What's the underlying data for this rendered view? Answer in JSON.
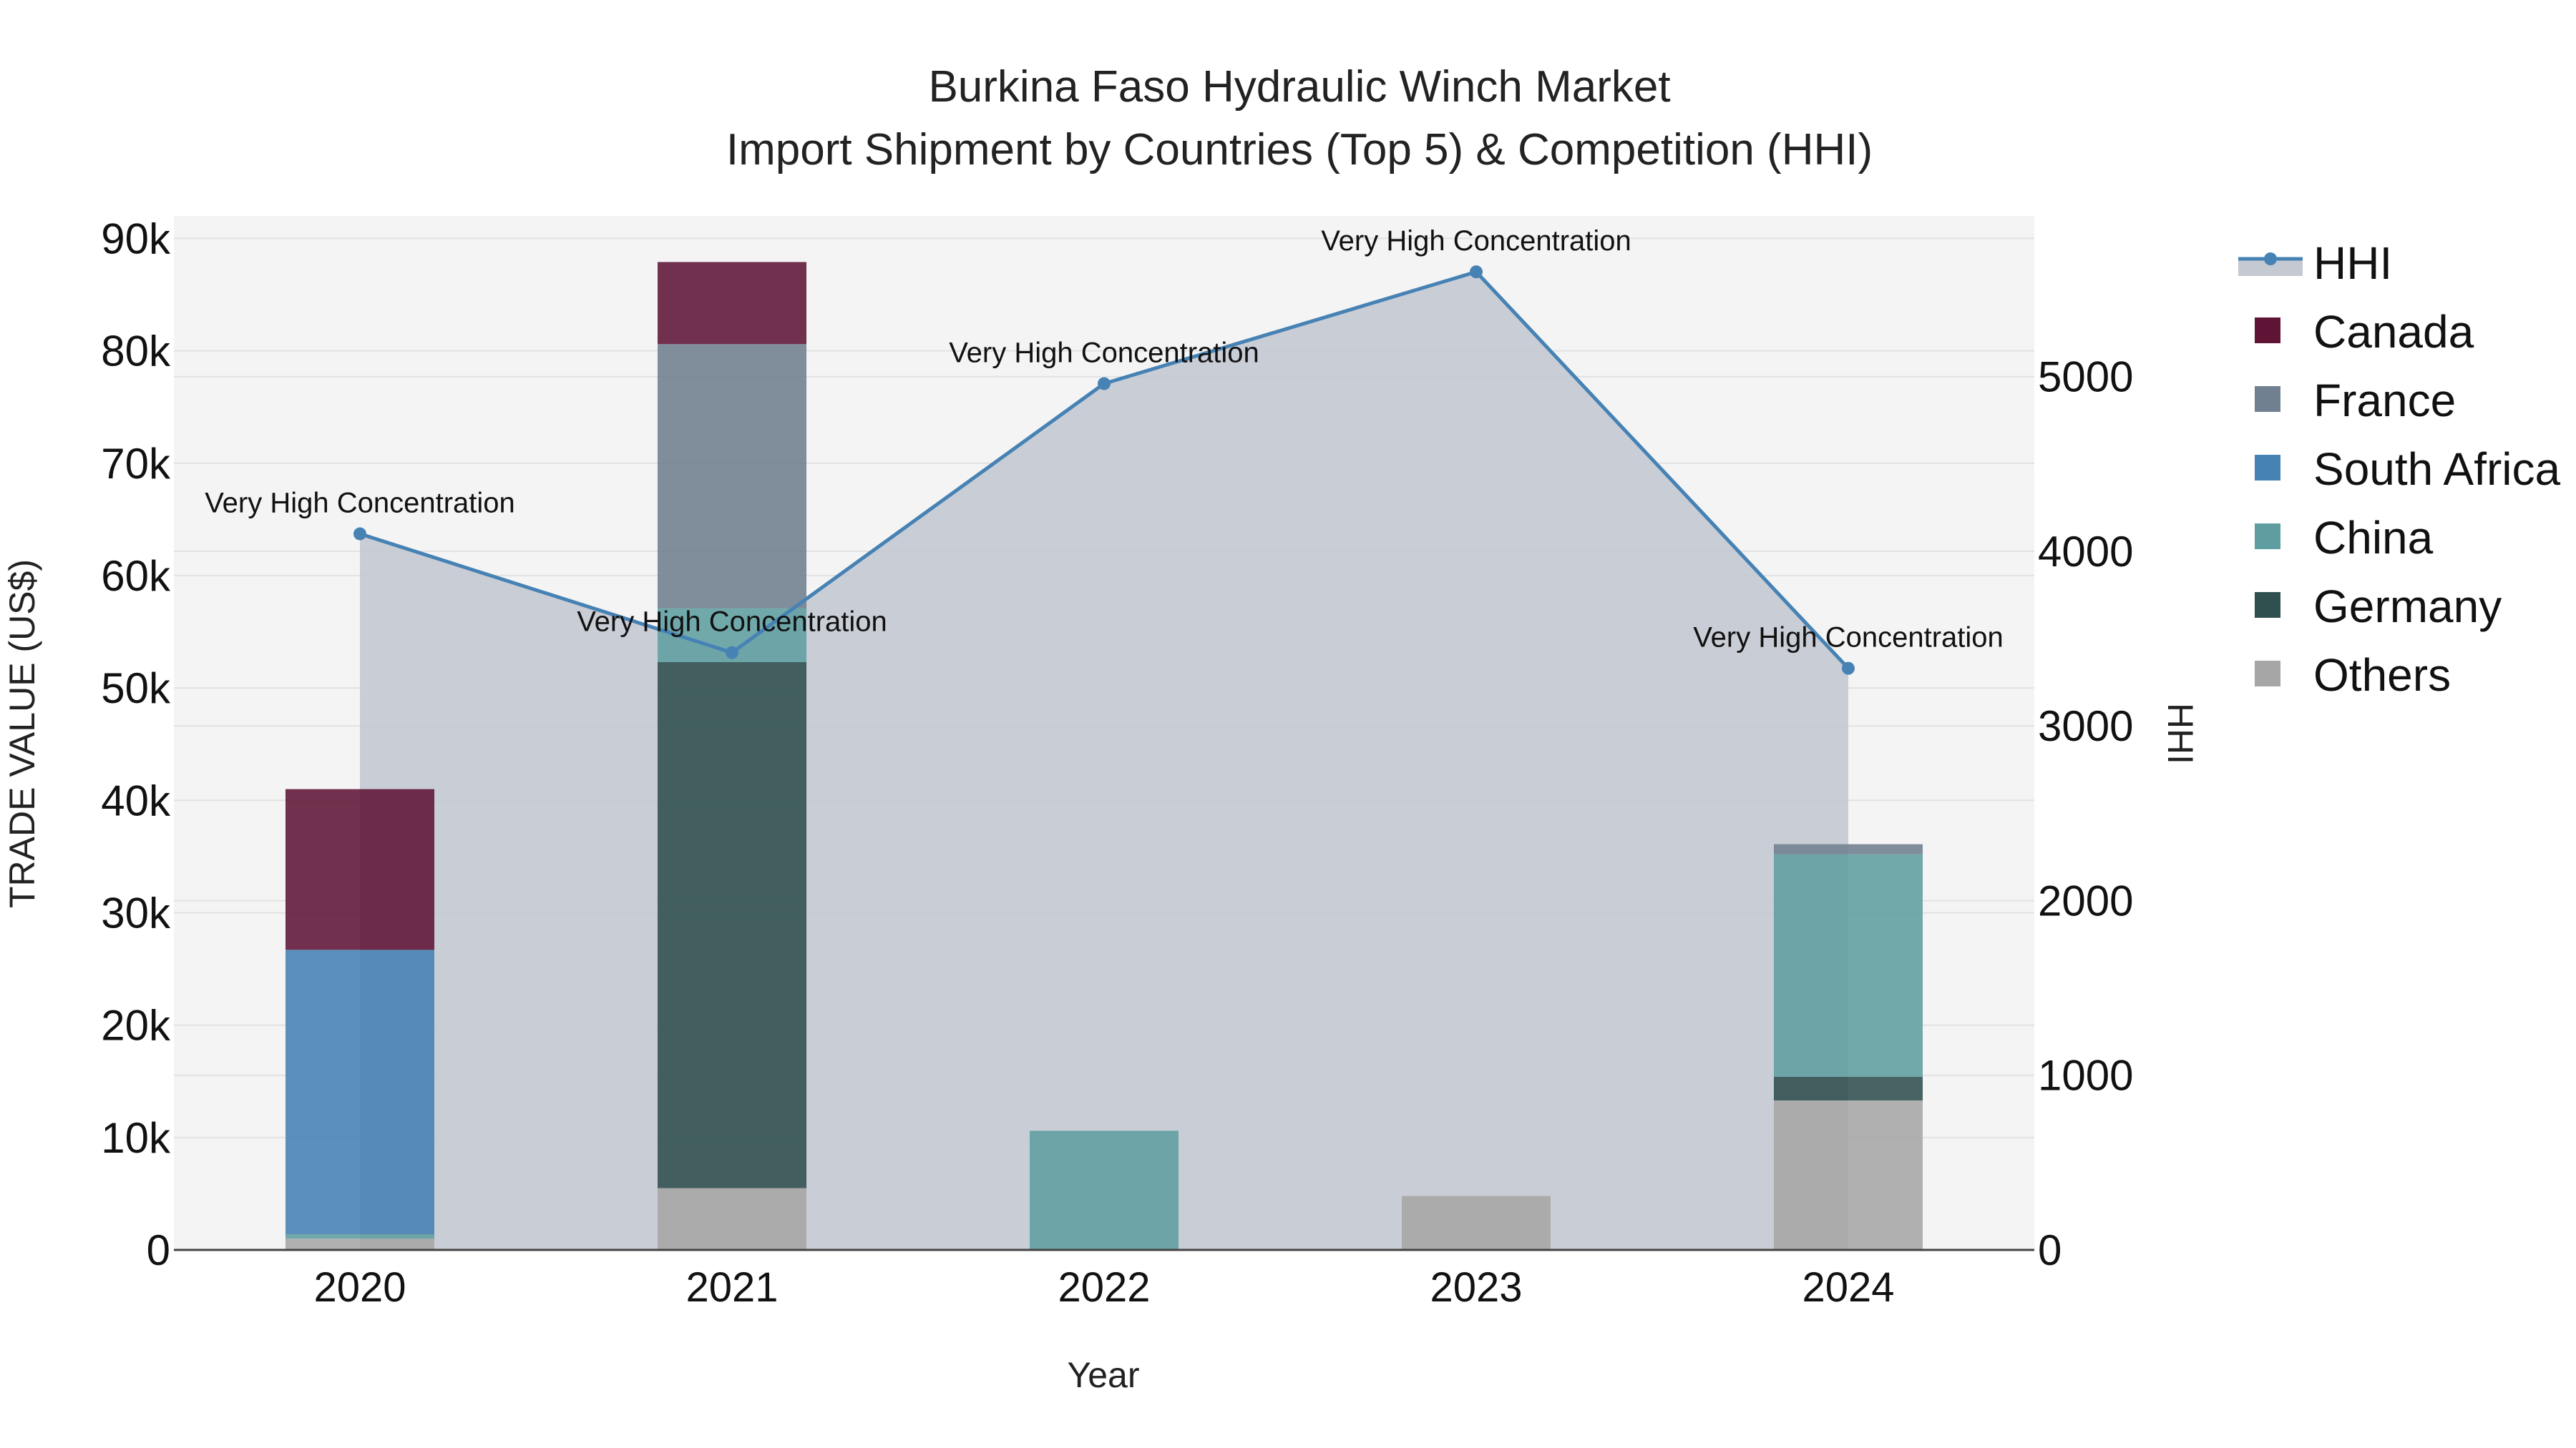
{
  "chart_data": {
    "type": "bar",
    "title": "Burkina Faso Hydraulic Winch Market",
    "subtitle": "Import Shipment by Countries (Top 5) & Competition (HHI)",
    "xlabel": "Year",
    "ylabel": "TRADE VALUE (US$)",
    "y2label": "HHI",
    "categories": [
      "2020",
      "2021",
      "2022",
      "2023",
      "2024"
    ],
    "ylim": [
      0,
      92000
    ],
    "y2lim": [
      0,
      5920
    ],
    "yticks": [
      0,
      10000,
      20000,
      30000,
      40000,
      50000,
      60000,
      70000,
      80000,
      90000
    ],
    "ytick_labels": [
      "0",
      "10k",
      "20k",
      "30k",
      "40k",
      "50k",
      "60k",
      "70k",
      "80k",
      "90k"
    ],
    "y2ticks": [
      0,
      1000,
      2000,
      3000,
      4000,
      5000
    ],
    "y2tick_labels": [
      "0",
      "1000",
      "2000",
      "3000",
      "4000",
      "5000"
    ],
    "grid": true,
    "legend_position": "right",
    "series": [
      {
        "name": "Others",
        "color": "#a6a6a6",
        "values": [
          1000,
          5500,
          0,
          4800,
          13300
        ]
      },
      {
        "name": "Germany",
        "color": "#2f4f4f",
        "values": [
          0,
          46800,
          0,
          0,
          2100
        ]
      },
      {
        "name": "China",
        "color": "#5f9ea0",
        "values": [
          400,
          4800,
          10600,
          0,
          19800
        ]
      },
      {
        "name": "South Africa",
        "color": "#4682b4",
        "values": [
          25300,
          0,
          0,
          0,
          0
        ]
      },
      {
        "name": "France",
        "color": "#708090",
        "values": [
          0,
          23500,
          0,
          0,
          900
        ]
      },
      {
        "name": "Canada",
        "color": "#5f1435",
        "values": [
          14300,
          7300,
          0,
          0,
          0
        ]
      }
    ],
    "hhi": {
      "name": "HHI",
      "color": "#4682b4",
      "values": [
        4100,
        3420,
        4960,
        5600,
        3330
      ],
      "annotations": [
        "Very High Concentration",
        "Very High Concentration",
        "Very High Concentration",
        "Very High Concentration",
        "Very High Concentration"
      ]
    },
    "legend_order": [
      "HHI",
      "Canada",
      "France",
      "South Africa",
      "China",
      "Germany",
      "Others"
    ]
  }
}
